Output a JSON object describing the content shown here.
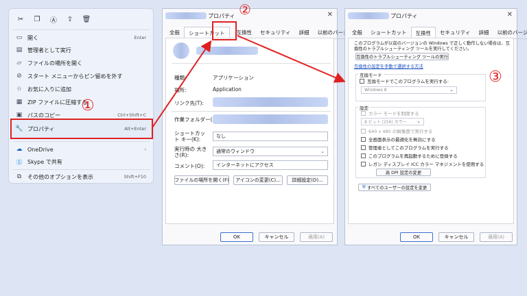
{
  "context_menu": {
    "toolbar_icons": [
      "cut-icon",
      "copy-icon",
      "rename-icon",
      "share-icon",
      "delete-icon"
    ],
    "items": [
      {
        "icon": "open-icon",
        "label": "開く",
        "shortcut": "Enter"
      },
      {
        "icon": "admin-shield-icon",
        "label": "管理者として実行",
        "shortcut": ""
      },
      {
        "icon": "folder-icon",
        "label": "ファイルの場所を開く",
        "shortcut": ""
      },
      {
        "icon": "pin-icon",
        "label": "スタート メニューからピン留めを外す",
        "shortcut": ""
      },
      {
        "icon": "star-icon",
        "label": "お気に入りに追加",
        "shortcut": ""
      },
      {
        "icon": "zip-icon",
        "label": "ZIP ファイルに圧縮する",
        "shortcut": ""
      },
      {
        "icon": "copy-path-icon",
        "label": "パスのコピー",
        "shortcut": "Ctrl+Shift+C"
      },
      {
        "icon": "wrench-icon",
        "label": "プロパティ",
        "shortcut": "Alt+Enter"
      },
      {
        "icon": "onedrive-icon",
        "label": "OneDrive",
        "shortcut": "›"
      },
      {
        "icon": "skype-icon",
        "label": "Skype で共有",
        "shortcut": ""
      },
      {
        "icon": "more-options-icon",
        "label": "その他のオプションを表示",
        "shortcut": "Shift+F10"
      }
    ]
  },
  "annotations": {
    "step1": "①",
    "step2": "②",
    "step3": "③"
  },
  "props_dialog": {
    "title": "プロパティ",
    "close": "✕",
    "tabs": [
      "全般",
      "ショートカット",
      "互換性",
      "セキュリティ",
      "詳細",
      "以前のバージョン"
    ],
    "type_label": "種類:",
    "type_value": "アプリケーション",
    "location_label": "場所:",
    "location_value": "Application",
    "target_label": "リンク先(T):",
    "workdir_label": "作業フォルダー(S):",
    "shortcut_key_label": "ショートカット キー(K):",
    "shortcut_key_value": "なし",
    "run_label": "実行時の 大きさ(R):",
    "run_value": "通常のウィンドウ",
    "comment_label": "コメント(O):",
    "comment_value": "インターネットにアクセス",
    "btn_open_location": "ファイルの場所を開く(F)",
    "btn_change_icon": "アイコンの変更(C)...",
    "btn_advanced": "詳細設定(D)...",
    "ok": "OK",
    "cancel": "キャンセル",
    "apply": "適用(A)"
  },
  "compat_dialog": {
    "title": "プロパティ",
    "close": "✕",
    "tabs": [
      "全般",
      "ショートカット",
      "互換性",
      "セキュリティ",
      "詳細",
      "以前のバージョン"
    ],
    "intro": "このプログラムが以前のバージョンの Windows で正しく動作しない場合は、互換性のトラブルシューティング ツールを実行してください。",
    "btn_troubleshoot": "互換性のトラブルシューティング ツールの実行",
    "manual_link": "互換性の設定を手動で選択する方法",
    "mode_group": "互換モード",
    "mode_check": "互換モードでこのプログラムを実行する:",
    "mode_select": "Windows 8",
    "settings_group": "設定",
    "settings": [
      {
        "label": "カラー モードを制限する",
        "disabled": true
      },
      {
        "label": "8 ビット (256) カラー",
        "disabled": true,
        "select": true
      },
      {
        "label": "640 x 480 の解像度で実行する",
        "disabled": true
      },
      {
        "label": "全画面表示の最適化を無効にする",
        "disabled": false
      },
      {
        "label": "管理者としてこのプログラムを実行する",
        "disabled": false
      },
      {
        "label": "このプログラムを再起動するために登録する",
        "disabled": false
      },
      {
        "label": "レガシ ディスプレイ ICC カラー マネジメントを使用する",
        "disabled": false
      }
    ],
    "btn_dpi": "高 DPI 設定の変更",
    "btn_all_users": "すべてのユーザーの設定を変更",
    "ok": "OK",
    "cancel": "キャンセル",
    "apply": "適用(A)"
  }
}
